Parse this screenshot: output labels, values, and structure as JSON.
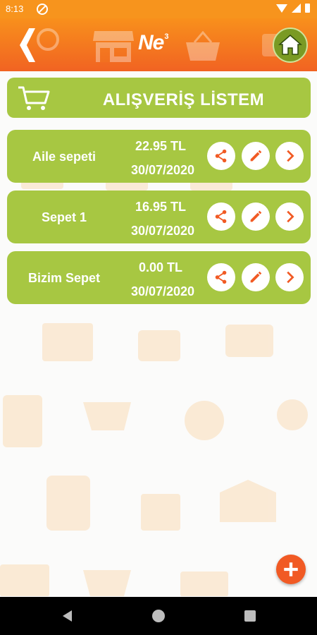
{
  "status_bar": {
    "time": "8:13"
  },
  "app_bar": {
    "logo_text": "Ne",
    "logo_sup": "3"
  },
  "title": "ALIŞVERİŞ LİSTEM",
  "lists": [
    {
      "name": "Aile sepeti",
      "amount": "22.95 TL",
      "date": "30/07/2020"
    },
    {
      "name": "Sepet 1",
      "amount": "16.95 TL",
      "date": "30/07/2020"
    },
    {
      "name": "Bizim Sepet",
      "amount": "0.00 TL",
      "date": "30/07/2020"
    }
  ],
  "colors": {
    "accent": "#f7941d",
    "card": "#a7c742",
    "fab": "#f15a24",
    "icon": "#f15a24"
  },
  "icons": [
    "back-icon",
    "home-icon",
    "cart-icon",
    "share-icon",
    "edit-icon",
    "chevron-right-icon",
    "add-icon"
  ]
}
